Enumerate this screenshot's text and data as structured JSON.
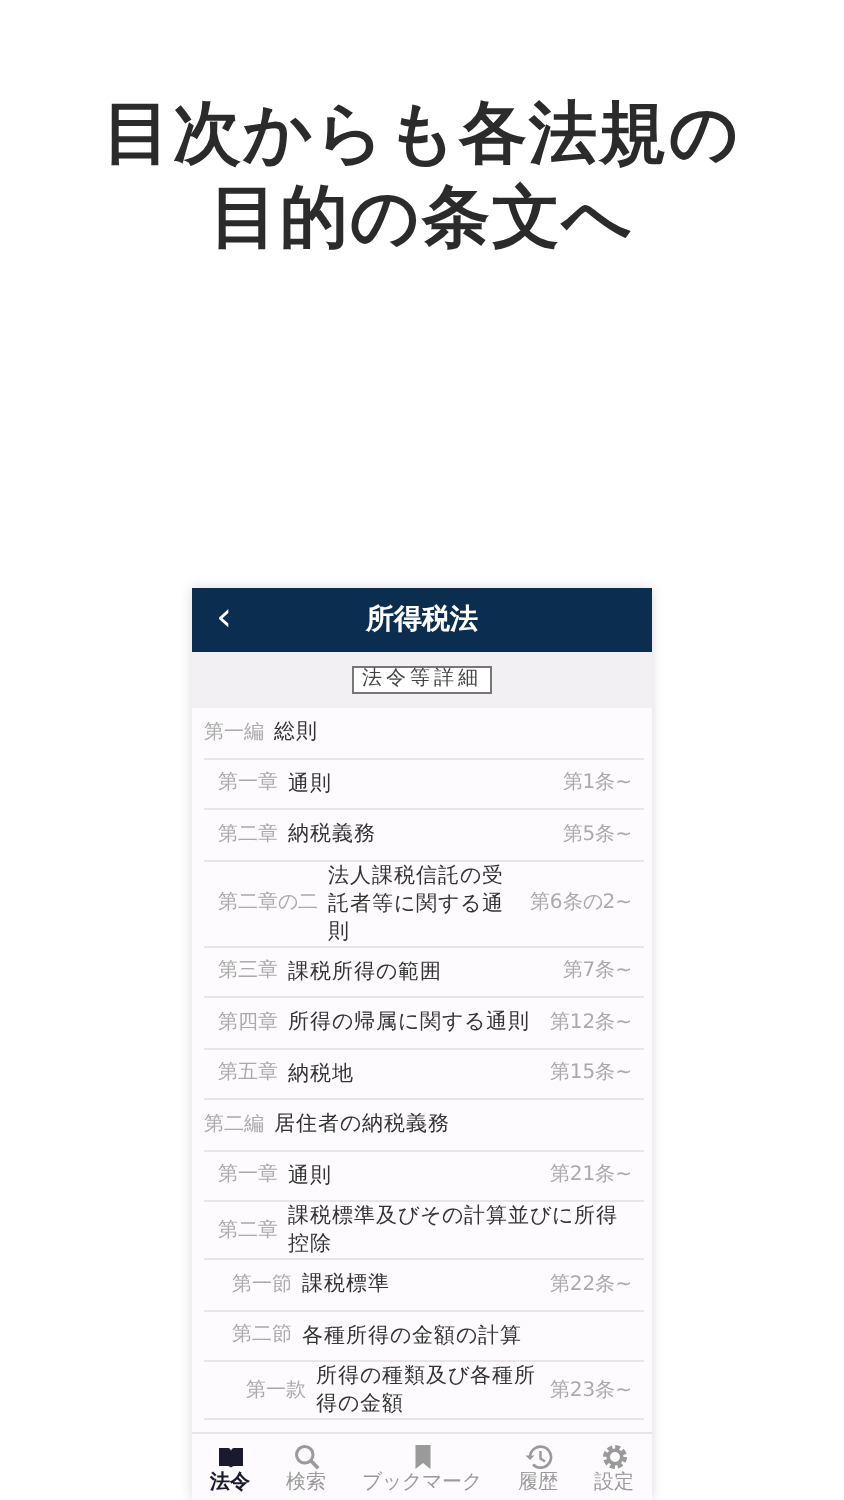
{
  "headline": [
    "目次からも各法規の",
    "目的の条文へ"
  ],
  "app": {
    "title": "所得税法",
    "back": "‹",
    "detail_button": "法令等詳細",
    "toc": [
      {
        "label": "第一編",
        "title": "総則",
        "children": [
          {
            "label": "第一章",
            "title": "通則",
            "article": "第1条~"
          },
          {
            "label": "第二章",
            "title": "納税義務",
            "article": "第5条~"
          },
          {
            "label": "第二章の二",
            "title": "法人課税信託の受託者等に関する通則",
            "article": "第6条の2~"
          },
          {
            "label": "第三章",
            "title": "課税所得の範囲",
            "article": "第7条~"
          },
          {
            "label": "第四章",
            "title": "所得の帰属に関する通則",
            "article": "第12条~"
          },
          {
            "label": "第五章",
            "title": "納税地",
            "article": "第15条~"
          }
        ]
      },
      {
        "label": "第二編",
        "title": "居住者の納税義務",
        "children": [
          {
            "label": "第一章",
            "title": "通則",
            "article": "第21条~"
          },
          {
            "label": "第二章",
            "title": "課税標準及びその計算並びに所得控除",
            "children": [
              {
                "label": "第一節",
                "title": "課税標準",
                "article": "第22条~"
              },
              {
                "label": "第二節",
                "title": "各種所得の金額の計算",
                "children": [
                  {
                    "label": "第一款",
                    "title": "所得の種類及び各種所得の金額",
                    "article": "第23条~"
                  }
                ]
              }
            ]
          }
        ]
      }
    ],
    "tabs": [
      {
        "kind": "book",
        "label": "法令",
        "selected": true
      },
      {
        "kind": "search",
        "label": "検索",
        "selected": false
      },
      {
        "kind": "bookmark",
        "label": "ブックマーク",
        "selected": false
      },
      {
        "kind": "history",
        "label": "履歴",
        "selected": false
      },
      {
        "kind": "settings",
        "label": "設定",
        "selected": false
      }
    ]
  }
}
